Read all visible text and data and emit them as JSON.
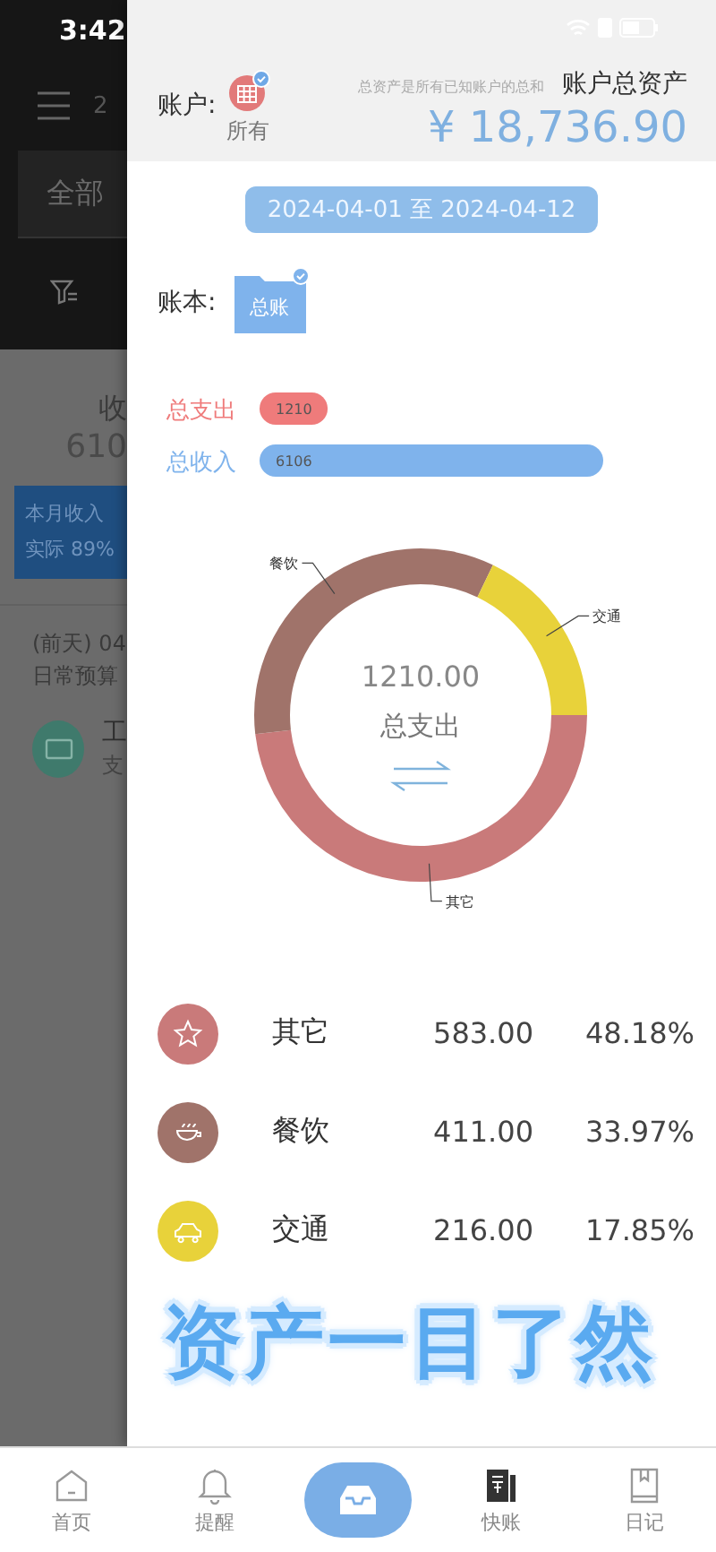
{
  "status_bar": {
    "time": "3:42"
  },
  "background_app": {
    "header_text": "2",
    "tab": "全部",
    "summary_label": "收",
    "summary_value": "610",
    "budget_card": [
      "本月收入",
      "实际 89%"
    ],
    "entry_date": "(前天) 04",
    "entry_note": "日常预算",
    "entry_title": "工",
    "entry_subtitle": "支"
  },
  "drawer": {
    "account_label": "账户:",
    "account_name": "所有",
    "assets_hint": "总资产是所有已知账户的总和",
    "assets_title": "账户总资产",
    "assets_total": "¥ 18,736.90",
    "date_range": "2024-04-01 至 2024-04-12",
    "book_label": "账本:",
    "book_name": "总账",
    "totals": {
      "chart_data": {
        "type": "bar",
        "orientation": "horizontal",
        "categories": [
          "总支出",
          "总收入"
        ],
        "values": [
          1210,
          6106
        ],
        "data_labels": true
      },
      "bars": [
        {
          "color": "#ef7b7b"
        },
        {
          "color": "#7fb3ec"
        }
      ]
    },
    "chart_center": {
      "value": "1210.00",
      "label": "总支出"
    },
    "chart_data": {
      "type": "donut",
      "categories": [
        "其它",
        "餐饮",
        "交通"
      ],
      "values": [
        48.18,
        33.97,
        17.85
      ]
    },
    "categories": [
      {
        "kind": "star",
        "name": "其它",
        "amount": "583.00",
        "percent": "48.18%",
        "color": "#c97a7a"
      },
      {
        "kind": "cup",
        "name": "餐饮",
        "amount": "411.00",
        "percent": "33.97%",
        "color": "#a0736a"
      },
      {
        "kind": "car",
        "name": "交通",
        "amount": "216.00",
        "percent": "17.85%",
        "color": "#e8d23a"
      }
    ],
    "caption": "资产一目了然"
  },
  "nav": [
    {
      "kind": "home",
      "label": "首页",
      "selected": false
    },
    {
      "kind": "bell",
      "label": "提醒",
      "selected": false
    },
    {
      "kind": "fab",
      "selected": false
    },
    {
      "kind": "ledger",
      "label": "快账",
      "selected": true
    },
    {
      "kind": "diary",
      "label": "日记",
      "selected": false
    }
  ]
}
